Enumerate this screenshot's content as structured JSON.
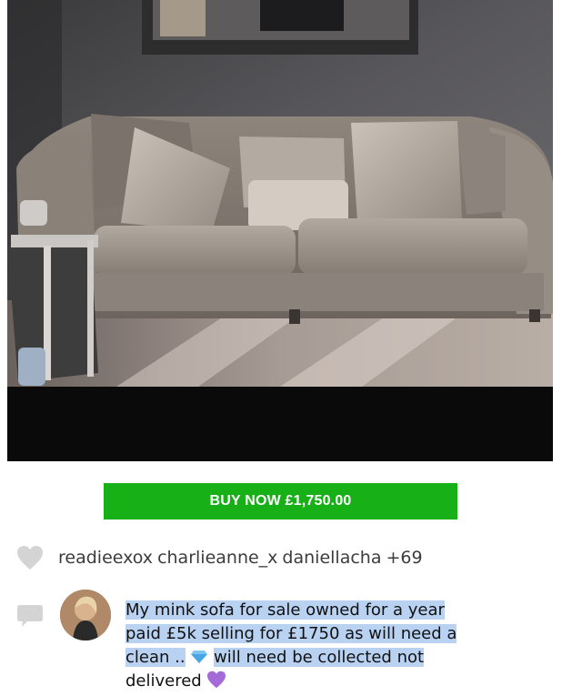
{
  "listing": {
    "buy_button": "BUY NOW £1,750.00"
  },
  "likes": {
    "users": [
      "readieexox",
      "charlieanne_x",
      "daniellacha"
    ],
    "more_count": "+69"
  },
  "comment": {
    "line1": "My mink sofa for sale owned for a year",
    "line2": "paid £5k selling for £1750 as will need a",
    "line3a": "clean ..",
    "diamond_emoji": "💎",
    "line3b": "will need be collected not",
    "line4": "delivered",
    "heart_emoji": "💜"
  },
  "icons": {
    "heart": "heart-icon",
    "comment": "speech-bubble-icon"
  },
  "colors": {
    "buy_button": "#17b117",
    "highlight": "#b9d2f2",
    "icon_gray": "#d4d4d4"
  }
}
